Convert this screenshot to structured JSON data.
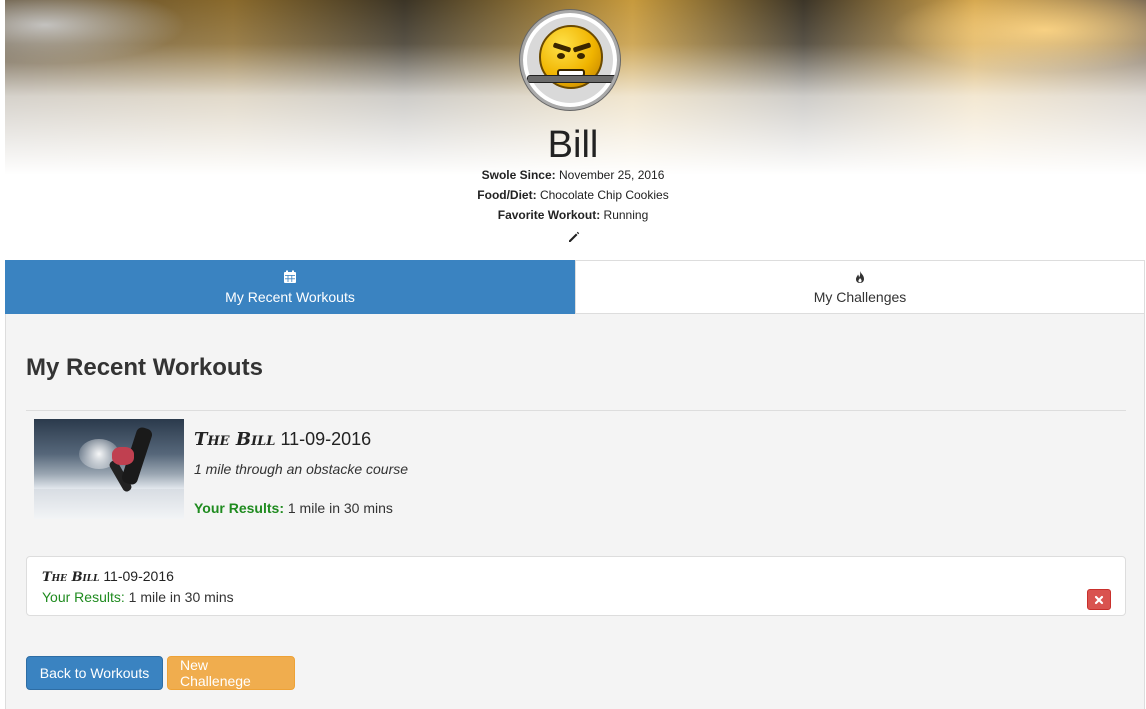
{
  "profile": {
    "name": "Bill",
    "swole_since_label": "Swole Since:",
    "swole_since_value": "November 25, 2016",
    "food_label": "Food/Diet:",
    "food_value": "Chocolate Chip Cookies",
    "workout_label": "Favorite Workout:",
    "workout_value": "Running",
    "edit_icon": "pencil-icon"
  },
  "tabs": [
    {
      "label": "My Recent Workouts",
      "icon": "calendar-icon",
      "active": true
    },
    {
      "label": "My Challenges",
      "icon": "fire-icon",
      "active": false
    }
  ],
  "main": {
    "section_title": "My Recent Workouts",
    "workout": {
      "name": "The Bill",
      "date": "11-09-2016",
      "description": "1 mile through an obstacke course",
      "results_label": "Your Results:",
      "results_value": "1 mile in 30 mins"
    },
    "result_card": {
      "name": "The Bill",
      "date": "11-09-2016",
      "results_label": "Your Results:",
      "results_value": "1 mile in 30 mins",
      "delete_icon": "close-icon"
    },
    "buttons": {
      "back_label": "Back to Workouts",
      "new_label": "New Challenege"
    }
  },
  "colors": {
    "primary": "#3a83c1",
    "warning": "#f0ad4e",
    "danger": "#d9534f",
    "success_text": "#1f8b1f"
  }
}
